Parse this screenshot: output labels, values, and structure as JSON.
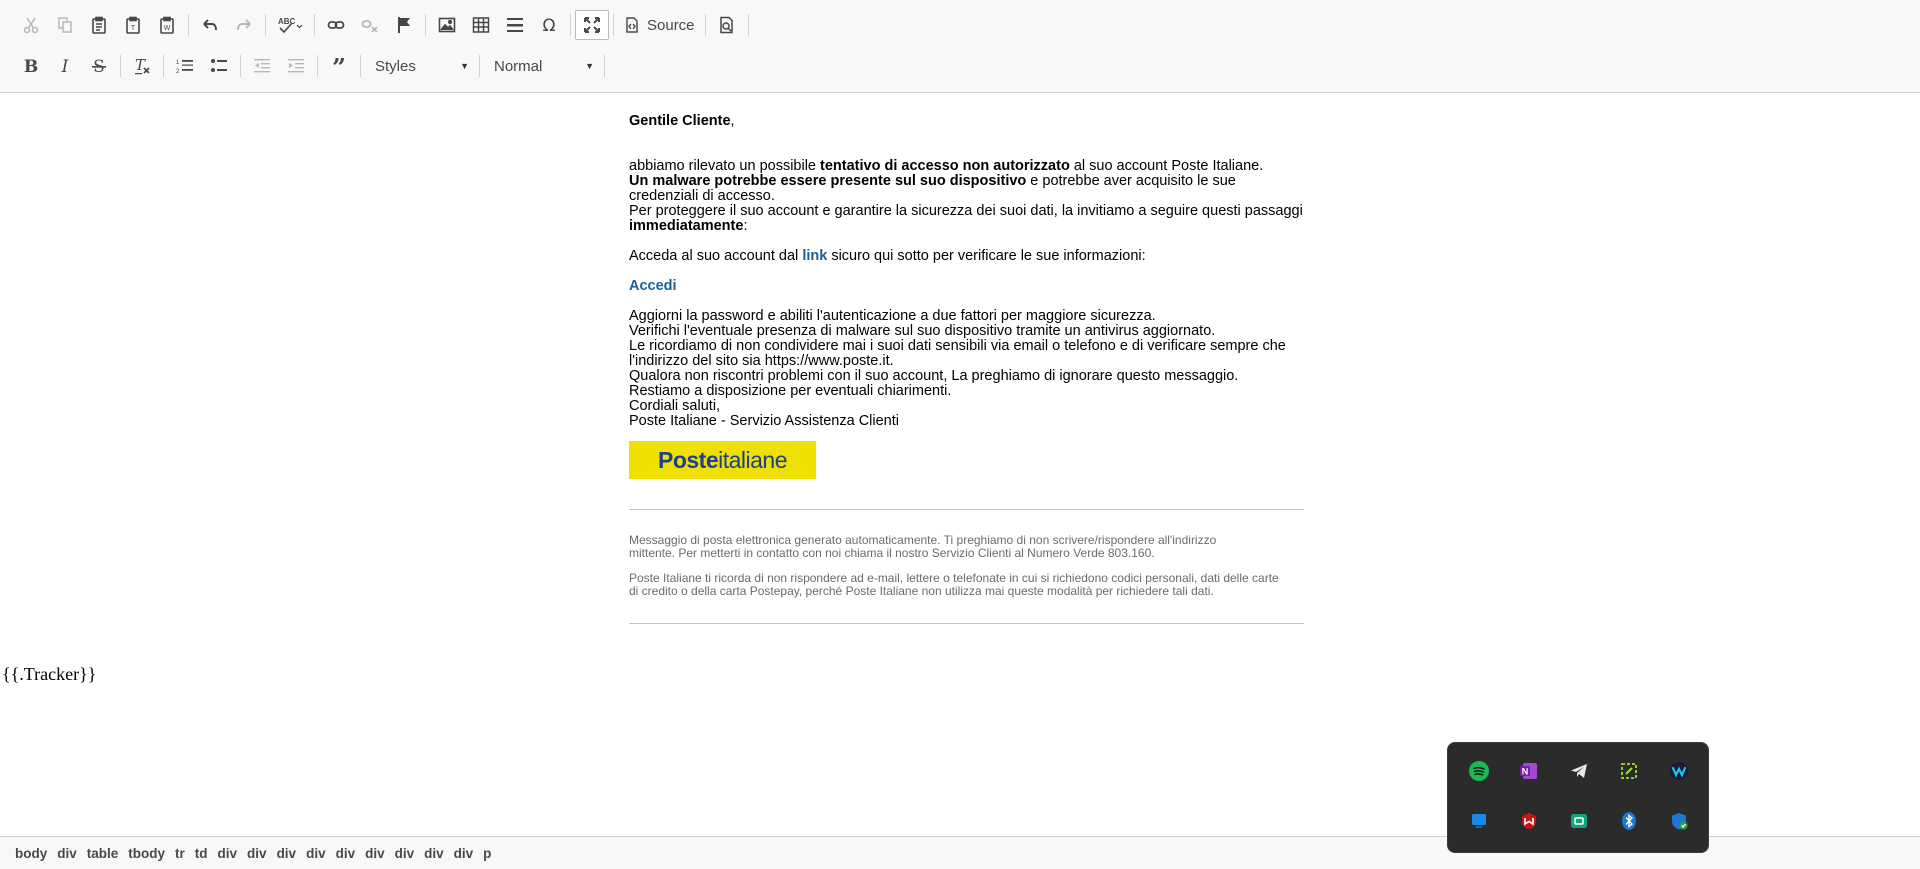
{
  "toolbar": {
    "row1": [
      {
        "name": "cut-button",
        "icon": "scissors-icon",
        "disabled": true
      },
      {
        "name": "copy-button",
        "icon": "copy-icon",
        "disabled": true
      },
      {
        "name": "paste-button",
        "icon": "clipboard-icon",
        "disabled": false
      },
      {
        "name": "paste-text-button",
        "icon": "clipboard-text-icon",
        "disabled": false
      },
      {
        "name": "paste-word-button",
        "icon": "clipboard-word-icon",
        "disabled": false
      },
      {
        "sep": true
      },
      {
        "name": "undo-button",
        "icon": "undo-icon",
        "disabled": false
      },
      {
        "name": "redo-button",
        "icon": "redo-icon",
        "disabled": true
      },
      {
        "sep": true
      },
      {
        "name": "spellcheck-button",
        "icon": "spellcheck-icon",
        "disabled": false
      },
      {
        "sep": true
      },
      {
        "name": "link-button",
        "icon": "link-icon",
        "disabled": false
      },
      {
        "name": "unlink-button",
        "icon": "unlink-icon",
        "disabled": true
      },
      {
        "name": "anchor-button",
        "icon": "flag-icon",
        "disabled": false
      },
      {
        "sep": true
      },
      {
        "name": "image-button",
        "icon": "image-icon",
        "disabled": false
      },
      {
        "name": "table-button",
        "icon": "table-icon",
        "disabled": false
      },
      {
        "name": "horizontal-rule-button",
        "icon": "horizontal-rule-icon",
        "disabled": false
      },
      {
        "name": "special-char-button",
        "icon": "omega-icon",
        "disabled": false
      },
      {
        "sep": true
      },
      {
        "name": "maximize-button",
        "icon": "maximize-icon",
        "disabled": false,
        "active": true
      },
      {
        "sep": true
      },
      {
        "name": "source-button",
        "icon": "source-icon",
        "label": "Source"
      },
      {
        "sep": true
      },
      {
        "name": "preview-button",
        "icon": "preview-icon",
        "disabled": false
      },
      {
        "sep": true
      }
    ],
    "row2": [
      {
        "name": "bold-button",
        "icon": "bold-icon",
        "disabled": false
      },
      {
        "name": "italic-button",
        "icon": "italic-icon",
        "disabled": false
      },
      {
        "name": "strike-button",
        "icon": "strikethrough-icon",
        "disabled": false
      },
      {
        "sep": true
      },
      {
        "name": "remove-format-button",
        "icon": "remove-format-icon",
        "disabled": false
      },
      {
        "sep": true
      },
      {
        "name": "numbered-list-button",
        "icon": "numbered-list-icon",
        "disabled": false
      },
      {
        "name": "bulleted-list-button",
        "icon": "bulleted-list-icon",
        "disabled": false
      },
      {
        "sep": true
      },
      {
        "name": "outdent-button",
        "icon": "outdent-icon",
        "disabled": true
      },
      {
        "name": "indent-button",
        "icon": "indent-icon",
        "disabled": true
      },
      {
        "sep": true
      },
      {
        "name": "blockquote-button",
        "icon": "quote-icon",
        "disabled": false
      },
      {
        "sep": true
      },
      {
        "name": "styles-combo",
        "combo": true,
        "label": "Styles",
        "width": 110
      },
      {
        "sep": true
      },
      {
        "name": "format-combo",
        "combo": true,
        "label": "Normal",
        "width": 116
      },
      {
        "sep": true
      }
    ]
  },
  "mail": {
    "greeting": "Gentile Cliente",
    "greeting_comma": ",",
    "p1_a": "abbiamo rilevato un possibile ",
    "p1_b": "tentativo di accesso non autorizzato",
    "p1_c": " al suo account Poste Italiane.",
    "p2_a": "Un malware potrebbe essere presente sul suo dispositivo",
    "p2_b": " e potrebbe aver acquisito le sue credenziali di accesso.",
    "p3_a": "Per proteggere il suo account e garantire la sicurezza dei suoi dati, la invitiamo a seguire questi passaggi ",
    "p3_b": "immediatamente",
    "p3_c": ":",
    "p4_a": "Acceda al suo account dal ",
    "p4_link": "link",
    "p4_b": " sicuro qui sotto per verificare le sue informazioni:",
    "accedi": "Accedi",
    "l1": "Aggiorni la password e abiliti l'autenticazione a due fattori per maggiore sicurezza.",
    "l2": "Verifichi l'eventuale presenza di malware sul suo dispositivo tramite un antivirus aggiornato.",
    "l3": "Le ricordiamo di non condividere mai i suoi dati sensibili via email o telefono e di verificare sempre che l'indirizzo del sito sia https://www.poste.it.",
    "l4": "Qualora non riscontri problemi con il suo account, La preghiamo di ignorare questo messaggio.",
    "l5": "Restiamo a disposizione per eventuali chiarimenti.",
    "l6": "Cordiali saluti,",
    "l7": "Poste Italiane - Servizio Assistenza Clienti",
    "logo_bold": "Poste",
    "logo_regular": "italiane",
    "footer1": "Messaggio di posta elettronica generato automaticamente. Ti preghiamo di non scrivere/rispondere all'indirizzo mittente. Per metterti in contatto con noi chiama il nostro Servizio Clienti al Numero Verde 803.160.",
    "footer2": "Poste Italiane ti ricorda di non rispondere ad e-mail, lettere o telefonate in cui si richiedono codici personali, dati delle carte di credito o della carta Postepay, perché Poste Italiane non utilizza mai queste modalità per richiedere tali dati."
  },
  "tracker": "{{.Tracker}}",
  "breadcrumbs": [
    "body",
    "div",
    "table",
    "tbody",
    "tr",
    "td",
    "div",
    "div",
    "div",
    "div",
    "div",
    "div",
    "div",
    "div",
    "div",
    "p"
  ],
  "tray": {
    "icons": [
      {
        "name": "spotify-icon",
        "color": "#1db954",
        "glyph": ""
      },
      {
        "name": "onenote-icon",
        "color": "#7719aa",
        "glyph": "N"
      },
      {
        "name": "telegram-icon",
        "color": "transparent",
        "glyph": ""
      },
      {
        "name": "snipping-tool-icon",
        "color": "transparent",
        "glyph": ""
      },
      {
        "name": "webex-icon",
        "color": "#0a1a3a",
        "glyph": ""
      },
      {
        "name": "windows-app-icon",
        "color": "#1e88e5",
        "glyph": ""
      },
      {
        "name": "mcafee-icon",
        "color": "transparent",
        "glyph": ""
      },
      {
        "name": "teams-icon",
        "color": "#0f9d8a",
        "glyph": ""
      },
      {
        "name": "bluetooth-icon",
        "color": "#1976d2",
        "glyph": ""
      },
      {
        "name": "windows-security-icon",
        "color": "transparent",
        "glyph": ""
      }
    ]
  }
}
